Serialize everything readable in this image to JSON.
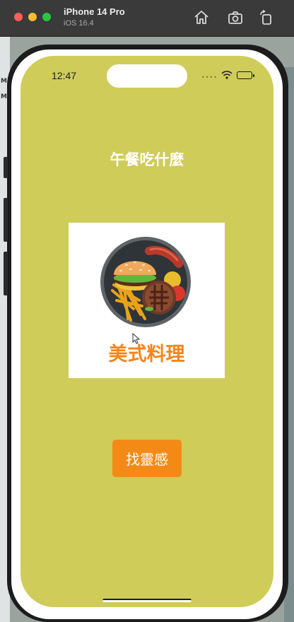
{
  "window": {
    "device_name": "iPhone 14 Pro",
    "os_version": "iOS 16.4",
    "icons": [
      "home-icon",
      "screenshot-icon",
      "rotate-icon"
    ]
  },
  "status_bar": {
    "time": "12:47"
  },
  "app": {
    "title": "午餐吃什麼",
    "card": {
      "image_icon": "food-plate-icon",
      "label": "美式料理"
    },
    "button_label": "找靈感"
  },
  "colors": {
    "screen_background": "#cfcc5a",
    "accent_orange": "#f4851b",
    "button_orange": "#f48a16"
  }
}
